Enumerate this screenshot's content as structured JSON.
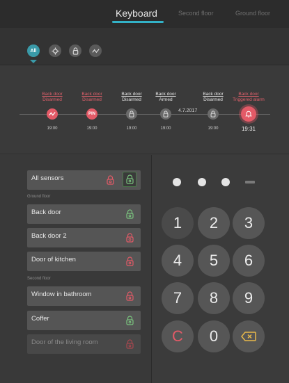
{
  "tabs": [
    {
      "label": "Keyboard",
      "active": true
    },
    {
      "label": "Second floor",
      "active": false
    },
    {
      "label": "Ground floor",
      "active": false
    }
  ],
  "filters": {
    "all_label": "All",
    "icons": [
      "gear-icon",
      "lock-icon",
      "motion-icon"
    ]
  },
  "timeline": {
    "date": "4.7.2017",
    "events": [
      {
        "name": "Back door",
        "state": "Disarmed",
        "time": "19:00",
        "kind": "alarm",
        "icon": "motion-icon"
      },
      {
        "name": "Back door",
        "state": "Disarmed",
        "time": "19:00",
        "kind": "alarm",
        "icon": "pin",
        "pin_label": "PIN"
      },
      {
        "name": "Back door",
        "state": "Disarmed",
        "time": "19:00",
        "kind": "normal",
        "icon": "lock-icon"
      },
      {
        "name": "Back door",
        "state": "Armed",
        "time": "19:00",
        "kind": "normal",
        "icon": "lock-icon"
      },
      {
        "name": "Back door",
        "state": "Disarmed",
        "time": "19:00",
        "kind": "normal",
        "icon": "lock-icon"
      },
      {
        "name": "Back door",
        "state": "Triggered alarm",
        "time": "19:31",
        "kind": "alarm",
        "icon": "alarm-icon"
      }
    ]
  },
  "sensors": {
    "all_label": "All sensors",
    "ground_floor_label": "Ground floor",
    "second_floor_label": "Second floor",
    "ground_floor": [
      {
        "label": "Back door",
        "status": "green"
      },
      {
        "label": "Back door 2",
        "status": "red"
      },
      {
        "label": "Door of kitchen",
        "status": "red"
      }
    ],
    "second_floor": [
      {
        "label": "Window in bathroom",
        "status": "red"
      },
      {
        "label": "Coffer",
        "status": "green"
      },
      {
        "label": "Door of the living room",
        "status": "red",
        "dim": true
      }
    ]
  },
  "keypad": {
    "entered_digits": 3,
    "keys": [
      "1",
      "2",
      "3",
      "4",
      "5",
      "6",
      "7",
      "8",
      "9",
      "C",
      "0"
    ],
    "backspace_icon": "backspace-icon"
  },
  "colors": {
    "accent": "#33b2c7",
    "alarm": "#e35a67",
    "ok": "#7bc47f"
  }
}
